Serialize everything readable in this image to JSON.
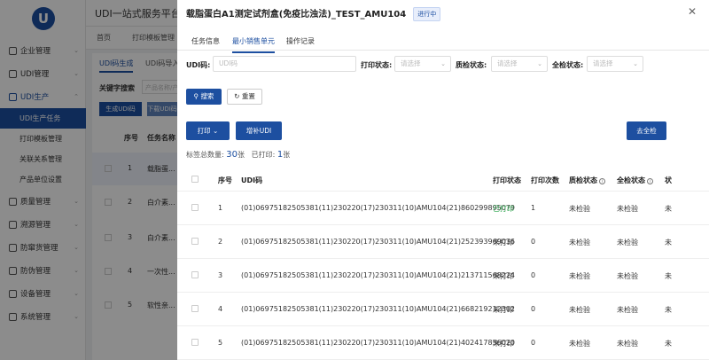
{
  "app": {
    "title": "UDI一站式服务平台",
    "menu": [
      {
        "label": "企业管理"
      },
      {
        "label": "UDI管理"
      },
      {
        "label": "UDI生产"
      },
      {
        "label": "质量管理"
      },
      {
        "label": "溯源管理"
      },
      {
        "label": "防窜货管理"
      },
      {
        "label": "防伪管理"
      },
      {
        "label": "设备管理"
      },
      {
        "label": "系统管理"
      }
    ],
    "submenu": [
      {
        "label": "UDI生产任务"
      },
      {
        "label": "打印模板管理"
      },
      {
        "label": "关联关系管理"
      },
      {
        "label": "产品单位设置"
      }
    ],
    "breadcrumb": [
      "首页",
      "打印模板管理"
    ],
    "content_tabs": [
      "UDI码生成",
      "UDI码导入"
    ],
    "keyword_label": "关键字搜索",
    "keyword_placeholder": "产品名称/产",
    "btn_generate": "生成UDI码",
    "btn_download": "下载UDI码",
    "table_head": [
      "序号",
      "任务名称"
    ],
    "rows": [
      {
        "n": "1",
        "name": "载脂蛋..."
      },
      {
        "n": "2",
        "name": "白介素..."
      },
      {
        "n": "3",
        "name": "白介素..."
      },
      {
        "n": "4",
        "name": "一次性..."
      },
      {
        "n": "5",
        "name": "软性亲..."
      }
    ]
  },
  "drawer": {
    "title": "载脂蛋白A1测定试剂盒(免疫比浊法)_TEST_AMU104",
    "status": "进行中",
    "close_icon": "close-icon",
    "tabs": [
      "任务信息",
      "最小销售单元",
      "操作记录"
    ],
    "filters": {
      "udi_label": "UDI码:",
      "udi_placeholder": "UDI码",
      "print_label": "打印状态:",
      "print_placeholder": "请选择",
      "quality_label": "质检状态:",
      "quality_placeholder": "请选择",
      "full_label": "全检状态:",
      "full_placeholder": "请选择"
    },
    "buttons": {
      "search": "搜索",
      "reset": "重置",
      "print": "打印",
      "add_udi": "增补UDI",
      "full_check": "去全检"
    },
    "counts": {
      "total_label": "标签总数量:",
      "total": "30",
      "total_unit": "张",
      "printed_label": "已打印:",
      "printed": "1",
      "printed_unit": "张"
    },
    "columns": [
      "序号",
      "UDI码",
      "打印状态",
      "打印次数",
      "质检状态",
      "全检状态",
      "状"
    ],
    "rows": [
      {
        "n": "1",
        "udi": "(01)06975182505381(11)230220(17)230311(10)AMU104(21)860299895079",
        "print_status": "已打印",
        "print_count": "1",
        "quality": "未检验",
        "full": "未检验",
        "extra": "未"
      },
      {
        "n": "2",
        "udi": "(01)06975182505381(11)230220(17)230311(10)AMU104(21)252393969036",
        "print_status": "未打印",
        "print_count": "0",
        "quality": "未检验",
        "full": "未检验",
        "extra": "未"
      },
      {
        "n": "3",
        "udi": "(01)06975182505381(11)230220(17)230311(10)AMU104(21)213711568224",
        "print_status": "未打印",
        "print_count": "0",
        "quality": "未检验",
        "full": "未检验",
        "extra": "未"
      },
      {
        "n": "4",
        "udi": "(01)06975182505381(11)230220(17)230311(10)AMU104(21)668219212302",
        "print_status": "未打印",
        "print_count": "0",
        "quality": "未检验",
        "full": "未检验",
        "extra": "未"
      },
      {
        "n": "5",
        "udi": "(01)06975182505381(11)230220(17)230311(10)AMU104(21)402417856020",
        "print_status": "未打印",
        "print_count": "0",
        "quality": "未检验",
        "full": "未检验",
        "extra": "未"
      }
    ]
  }
}
